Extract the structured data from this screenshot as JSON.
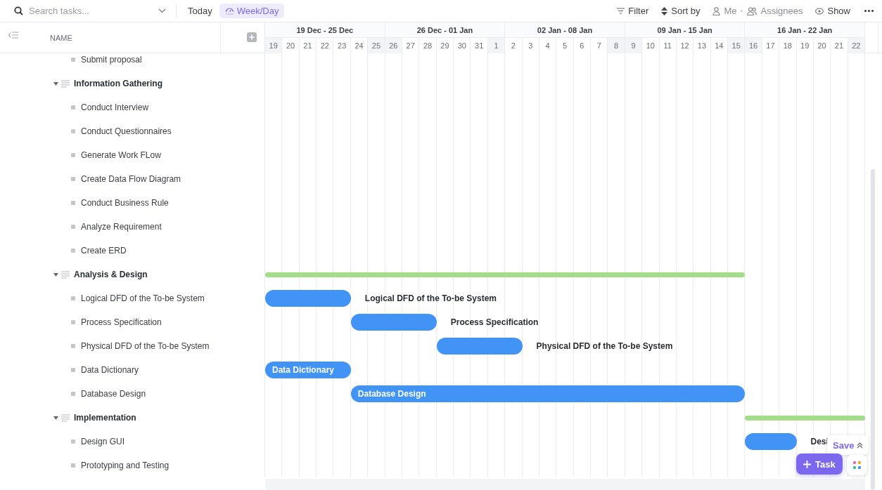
{
  "toolbar": {
    "search": {
      "placeholder": "Search tasks..."
    },
    "today": "Today",
    "views": [
      {
        "label": "Week/Day",
        "selected": true
      }
    ],
    "actions": [
      {
        "kind": "filter",
        "label": "Filter",
        "dimmed": false
      },
      {
        "kind": "sort",
        "label": "Sort by",
        "dimmed": false
      },
      {
        "kind": "person",
        "label": "Me",
        "dimmed": true
      },
      {
        "kind": "people",
        "label": "Assignees",
        "dimmed": true
      },
      {
        "kind": "eye",
        "label": "Show",
        "dimmed": false
      }
    ]
  },
  "list": {
    "column": "NAME"
  },
  "timeline": {
    "weeks": [
      {
        "label": "19 Dec - 25 Dec"
      },
      {
        "label": "26 Dec - 01 Jan"
      },
      {
        "label": "02 Jan - 08 Jan"
      },
      {
        "label": "09 Jan - 15 Jan"
      },
      {
        "label": "16 Jan - 22 Jan"
      }
    ],
    "days": [
      {
        "label": "19",
        "weekend": true
      },
      {
        "label": "20",
        "weekend": false
      },
      {
        "label": "21",
        "weekend": false
      },
      {
        "label": "22",
        "weekend": false
      },
      {
        "label": "23",
        "weekend": false
      },
      {
        "label": "24",
        "weekend": false
      },
      {
        "label": "25",
        "weekend": true
      },
      {
        "label": "26",
        "weekend": true
      },
      {
        "label": "27",
        "weekend": false
      },
      {
        "label": "28",
        "weekend": false
      },
      {
        "label": "29",
        "weekend": false
      },
      {
        "label": "30",
        "weekend": false
      },
      {
        "label": "31",
        "weekend": false
      },
      {
        "label": "1",
        "weekend": true
      },
      {
        "label": "2",
        "weekend": false
      },
      {
        "label": "3",
        "weekend": false
      },
      {
        "label": "4",
        "weekend": false
      },
      {
        "label": "5",
        "weekend": false
      },
      {
        "label": "6",
        "weekend": false
      },
      {
        "label": "7",
        "weekend": false
      },
      {
        "label": "8",
        "weekend": true
      },
      {
        "label": "9",
        "weekend": true
      },
      {
        "label": "10",
        "weekend": false
      },
      {
        "label": "11",
        "weekend": false
      },
      {
        "label": "12",
        "weekend": false
      },
      {
        "label": "13",
        "weekend": false
      },
      {
        "label": "14",
        "weekend": false
      },
      {
        "label": "15",
        "weekend": true
      },
      {
        "label": "16",
        "weekend": true
      },
      {
        "label": "17",
        "weekend": false
      },
      {
        "label": "18",
        "weekend": false
      },
      {
        "label": "19",
        "weekend": false
      },
      {
        "label": "20",
        "weekend": false
      },
      {
        "label": "21",
        "weekend": false
      },
      {
        "label": "22",
        "weekend": true
      }
    ]
  },
  "rows": [
    {
      "kind": "task",
      "name": "Submit proposal"
    },
    {
      "kind": "group",
      "name": "Information Gathering",
      "expanded": true,
      "children": [
        {
          "kind": "task",
          "name": "Conduct Interview"
        },
        {
          "kind": "task",
          "name": "Conduct Questionnaires"
        },
        {
          "kind": "task",
          "name": "Generate Work FLow"
        },
        {
          "kind": "task",
          "name": "Create Data Flow Diagram"
        },
        {
          "kind": "task",
          "name": "Conduct Business Rule"
        },
        {
          "kind": "task",
          "name": "Analyze Requirement"
        },
        {
          "kind": "task",
          "name": "Create ERD"
        }
      ]
    },
    {
      "kind": "group",
      "name": "Analysis & Design",
      "expanded": true,
      "bar": {
        "kind": "summary"
      },
      "children": [
        {
          "kind": "task",
          "name": "Logical DFD of the To-be System",
          "bar": {
            "kind": "task",
            "label": "Logical DFD of the To-be System",
            "label_inside": false
          }
        },
        {
          "kind": "task",
          "name": "Process Specification",
          "bar": {
            "kind": "task",
            "label": "Process Specification",
            "label_inside": false
          }
        },
        {
          "kind": "task",
          "name": "Physical DFD of the To-be System",
          "bar": {
            "kind": "task",
            "label": "Physical DFD of the To-be System",
            "label_inside": false
          }
        },
        {
          "kind": "task",
          "name": "Data Dictionary",
          "bar": {
            "kind": "task",
            "label": "Data Dictionary",
            "label_inside": true
          }
        },
        {
          "kind": "task",
          "name": "Database Design",
          "bar": {
            "kind": "task",
            "label": "Database Design",
            "label_inside": true
          }
        }
      ]
    },
    {
      "kind": "group",
      "name": "Implementation",
      "expanded": true,
      "bar": {
        "kind": "summary"
      },
      "children": [
        {
          "kind": "task",
          "name": "Design GUI",
          "bar": {
            "kind": "task",
            "label": "Desi",
            "label_inside": false
          }
        },
        {
          "kind": "task",
          "name": "Prototyping and Testing"
        }
      ]
    }
  ],
  "floating": {
    "save": "Save",
    "task": "Task"
  }
}
